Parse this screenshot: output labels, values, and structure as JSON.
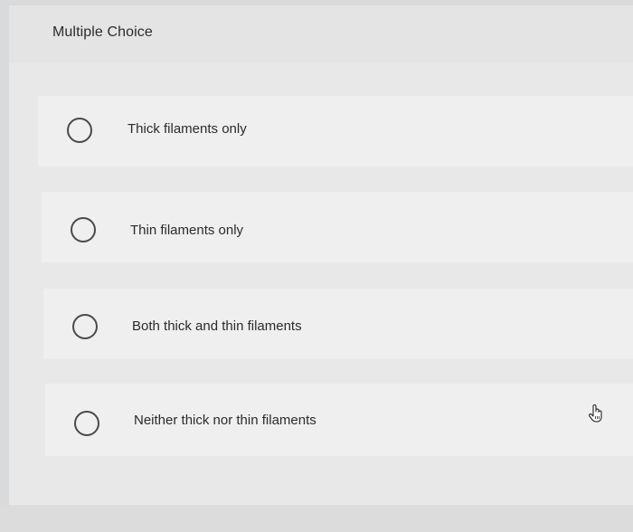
{
  "question": {
    "title": "Multiple Choice"
  },
  "options": [
    {
      "label": "Thick filaments only",
      "selected": false
    },
    {
      "label": "Thin filaments only",
      "selected": false
    },
    {
      "label": "Both thick and thin filaments",
      "selected": false
    },
    {
      "label": "Neither thick nor thin filaments",
      "selected": false
    }
  ],
  "cursor": {
    "icon": "hand-pointer-icon"
  }
}
